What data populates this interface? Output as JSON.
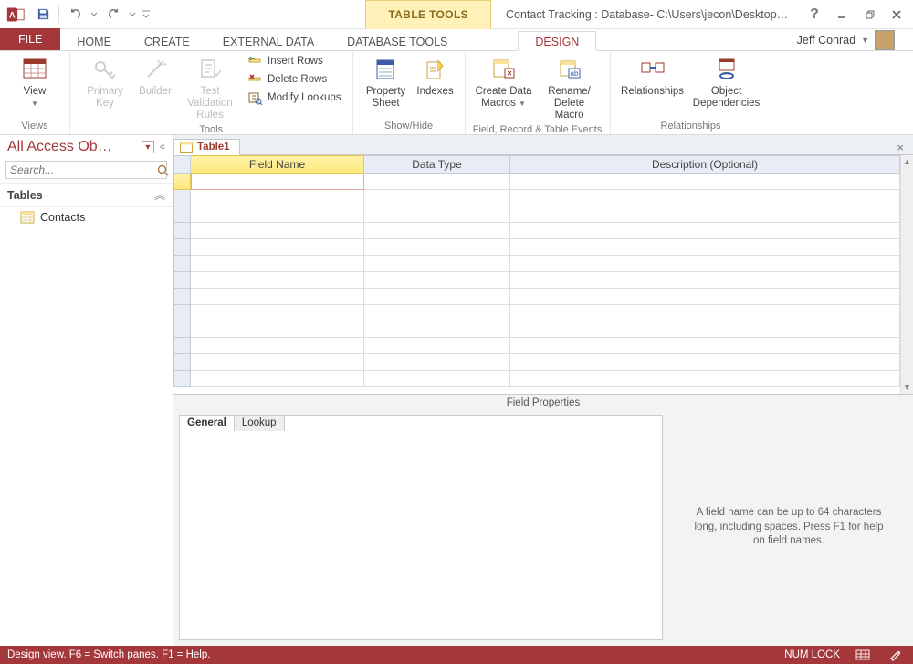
{
  "titlebar": {
    "context_tool_label": "TABLE TOOLS",
    "doc_title": "Contact Tracking : Database- C:\\Users\\jecon\\Desktop\\Contac...",
    "user_name": "Jeff Conrad"
  },
  "ribbon_tabs": {
    "file": "FILE",
    "home": "HOME",
    "create": "CREATE",
    "external": "EXTERNAL DATA",
    "dbtools": "DATABASE TOOLS",
    "design": "DESIGN"
  },
  "ribbon": {
    "views": {
      "view": "View",
      "group": "Views"
    },
    "tools": {
      "primary_key": "Primary Key",
      "builder": "Builder",
      "test_rules": "Test Validation Rules",
      "insert_rows": "Insert Rows",
      "delete_rows": "Delete Rows",
      "modify_lookups": "Modify Lookups",
      "group": "Tools"
    },
    "showhide": {
      "property_sheet": "Property Sheet",
      "indexes": "Indexes",
      "group": "Show/Hide"
    },
    "events": {
      "create_macros": "Create Data Macros",
      "rename_delete": "Rename/ Delete Macro",
      "group": "Field, Record & Table Events"
    },
    "relationships": {
      "relationships": "Relationships",
      "dependencies": "Object Dependencies",
      "group": "Relationships"
    }
  },
  "navpane": {
    "title": "All Access Ob…",
    "search_placeholder": "Search...",
    "group_tables": "Tables",
    "items": [
      {
        "label": "Contacts"
      }
    ]
  },
  "doc": {
    "tab_label": "Table1",
    "col_field_name": "Field Name",
    "col_data_type": "Data Type",
    "col_description": "Description (Optional)",
    "field_properties_title": "Field Properties",
    "prop_tabs": {
      "general": "General",
      "lookup": "Lookup"
    },
    "hint": "A field name can be up to 64 characters long, including spaces. Press F1 for help on field names."
  },
  "statusbar": {
    "left": "Design view.  F6 = Switch panes.  F1 = Help.",
    "numlock": "NUM LOCK"
  }
}
